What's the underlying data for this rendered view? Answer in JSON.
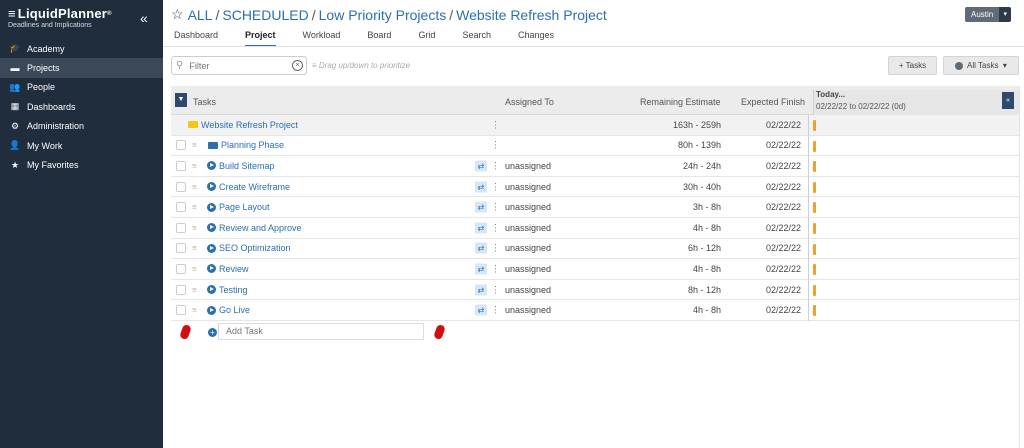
{
  "app": {
    "logo_title": "LiquidPlanner",
    "logo_registered": "®",
    "logo_sub": "Deadlines and Implications",
    "collapse_icon": "«"
  },
  "sidebar": {
    "items": [
      {
        "label": "Academy",
        "icon": "graduation-cap-icon",
        "glyph": "🎓",
        "active": false
      },
      {
        "label": "Projects",
        "icon": "folder-icon",
        "glyph": "▬",
        "active": true
      },
      {
        "label": "People",
        "icon": "people-icon",
        "glyph": "👥",
        "active": false
      },
      {
        "label": "Dashboards",
        "icon": "chart-icon",
        "glyph": "▦",
        "active": false
      },
      {
        "label": "Administration",
        "icon": "gear-icon",
        "glyph": "⚙",
        "active": false
      },
      {
        "label": "My Work",
        "icon": "person-icon",
        "glyph": "👤",
        "active": false
      },
      {
        "label": "My Favorites",
        "icon": "star-icon",
        "glyph": "★",
        "active": false
      }
    ]
  },
  "breadcrumb": {
    "star": "☆",
    "items": [
      "ALL",
      "SCHEDULED",
      "Low Priority Projects",
      "Website Refresh Project"
    ],
    "separator": "/"
  },
  "user": {
    "name": "Austin",
    "caret": "▾"
  },
  "tabs": [
    {
      "label": "Dashboard",
      "active": false
    },
    {
      "label": "Project",
      "active": true
    },
    {
      "label": "Workload",
      "active": false
    },
    {
      "label": "Board",
      "active": false
    },
    {
      "label": "Grid",
      "active": false
    },
    {
      "label": "Search",
      "active": false
    },
    {
      "label": "Changes",
      "active": false
    }
  ],
  "toolbar": {
    "filter_placeholder": "Filter",
    "filter_icon": "⚲",
    "clear_icon": "×",
    "hint": "Drag up/down to prioritize",
    "hint_icon": "≡",
    "tasks_button": "+ Tasks",
    "all_tasks_button": "All Tasks",
    "all_tasks_caret": "▾"
  },
  "grid": {
    "headers": {
      "tasks": "Tasks",
      "assigned": "Assigned To",
      "remaining": "Remaining Estimate",
      "finish": "Expected Finish",
      "today": "Today...",
      "range": "02/22/22 to 02/22/22 (0d)"
    },
    "toggle_icon": "▼",
    "expand_icon": "«",
    "rows": [
      {
        "type": "project",
        "name": "Website Refresh Project",
        "assigned": "",
        "remaining": "163h - 259h",
        "finish": "02/22/22"
      },
      {
        "type": "folder",
        "name": "Planning Phase",
        "assigned": "",
        "remaining": "80h - 139h",
        "finish": "02/22/22"
      },
      {
        "type": "task",
        "name": "Build Sitemap",
        "assigned": "unassigned",
        "remaining": "24h - 24h",
        "finish": "02/22/22"
      },
      {
        "type": "task",
        "name": "Create Wireframe",
        "assigned": "unassigned",
        "remaining": "30h - 40h",
        "finish": "02/22/22"
      },
      {
        "type": "task",
        "name": "Page Layout",
        "assigned": "unassigned",
        "remaining": "3h - 8h",
        "finish": "02/22/22"
      },
      {
        "type": "task",
        "name": "Review and Approve",
        "assigned": "unassigned",
        "remaining": "4h - 8h",
        "finish": "02/22/22"
      },
      {
        "type": "task",
        "name": "SEO Optimization",
        "assigned": "unassigned",
        "remaining": "6h - 12h",
        "finish": "02/22/22"
      },
      {
        "type": "task",
        "name": "Review",
        "assigned": "unassigned",
        "remaining": "4h - 8h",
        "finish": "02/22/22"
      },
      {
        "type": "task",
        "name": "Testing",
        "assigned": "unassigned",
        "remaining": "8h - 12h",
        "finish": "02/22/22"
      },
      {
        "type": "task",
        "name": "Go Live",
        "assigned": "unassigned",
        "remaining": "4h - 8h",
        "finish": "02/22/22"
      }
    ],
    "add_task_placeholder": "Add Task"
  },
  "colors": {
    "sidebar_bg": "#1f2d3d",
    "link": "#2c6fb0",
    "bar": "#f0a030",
    "project_folder": "#f5c518",
    "folder": "#2c6fb0"
  }
}
